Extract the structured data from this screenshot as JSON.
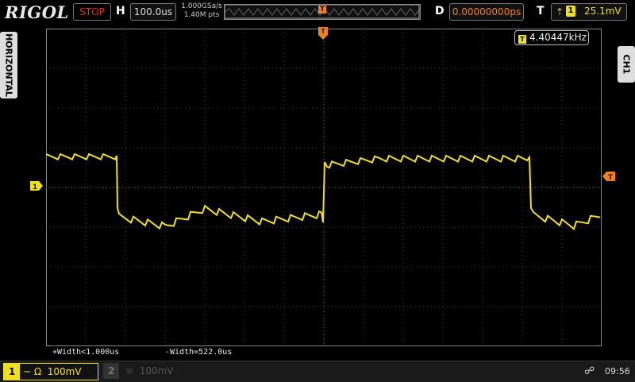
{
  "header": {
    "brand": "RIGOL",
    "run_status": "STOP",
    "timebase_label": "H",
    "timebase_value": "100.0us",
    "sample_rate": "1.000GSa/s",
    "memory_depth": "1.40M pts",
    "trigger_marker": "T",
    "delay_label": "D",
    "delay_value": "0.00000000ps",
    "trigger_label": "T",
    "trigger_edge_icon": "rising-edge-icon",
    "trigger_source": "1",
    "trigger_level": "25.1mV"
  },
  "side_labels": {
    "left": "HORIZONTAL",
    "right": "CH1"
  },
  "measurements": {
    "frequency_marker": "T",
    "frequency": "4.40447kHz",
    "pos_width": "+Width<1.000us",
    "neg_width": "-Width=522.0us"
  },
  "channels": [
    {
      "number": "1",
      "coupling": "~ Ω",
      "scale": "100mV",
      "active": true
    },
    {
      "number": "2",
      "coupling": "",
      "scale": "100mV",
      "active": false
    }
  ],
  "status": {
    "usb_icon": "usb-icon",
    "time": "09:56"
  },
  "colors": {
    "ch1": "#f0e020",
    "trigger": "#f08020",
    "stop": "#e03020"
  }
}
